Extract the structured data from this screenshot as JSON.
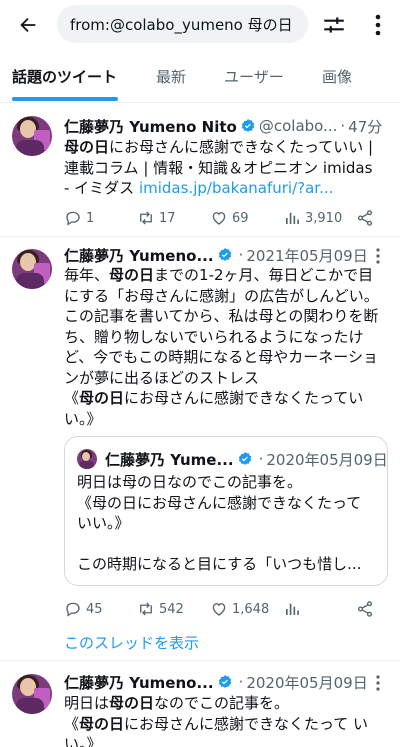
{
  "search": {
    "query": "from:@colabo_yumeno 母の日"
  },
  "tabs": [
    {
      "label": "話題のツイート"
    },
    {
      "label": "最新"
    },
    {
      "label": "ユーザー"
    },
    {
      "label": "画像"
    }
  ],
  "tweets": [
    {
      "name": "仁藤夢乃 Yumeno Nito",
      "handle": "@colabo...",
      "date": "47分",
      "text_bold": "母の日",
      "text_rest": "にお母さんに感謝できなくたっていい | 連載コラム | 情報・知識＆オピニオン imidas - イミダス ",
      "link": "imidas.jp/bakanafuri/?ar...",
      "replies": "1",
      "retweets": "17",
      "likes": "69",
      "views": "3,910"
    },
    {
      "name": "仁藤夢乃 Yumeno...",
      "date": "2021年05月09日",
      "text_pre": "毎年、",
      "text_bold1": "母の日",
      "text_mid": "までの1-2ヶ月、毎日どこかで目にする「お母さんに感謝」の広告がしんどい。この記事を書いてから、私は母との関わりを断ち、贈り物しないでいられるようになったけど、今でもこの時期になると母やカーネーションが夢に出るほどのストレス\n《",
      "text_bold2": "母の日",
      "text_end": "にお母さんに感謝できなくたってい い。》",
      "quote": {
        "name": "仁藤夢乃 Yume...",
        "date": "2020年05月09日",
        "text": "明日は母の日なのでこの記事を。\n《母の日にお母さんに感謝できなくたって いい。》\n\nこの時期になると目にする「いつも惜し..."
      },
      "replies": "45",
      "retweets": "542",
      "likes": "1,648",
      "thread_link": "このスレッドを表示"
    },
    {
      "name": "仁藤夢乃 Yumeno...",
      "date": "2020年05月09日",
      "text_pre": "明日は",
      "text_bold1": "母の日",
      "text_mid": "なのでこの記事を。\n《",
      "text_bold2": "母の日",
      "text_end": "にお母さんに感謝できなくたって いい。》"
    }
  ],
  "colors": {
    "accent": "#1d9bf0",
    "verified": "#1d9bf0",
    "muted": "#536471"
  },
  "icons": {
    "back": "arrow-left-icon",
    "filter": "sliders-icon",
    "more": "vertical-dots-icon",
    "reply": "reply-icon",
    "retweet": "retweet-icon",
    "like": "heart-icon",
    "views": "bar-chart-icon",
    "share": "share-icon",
    "verified": "verified-badge-icon"
  }
}
